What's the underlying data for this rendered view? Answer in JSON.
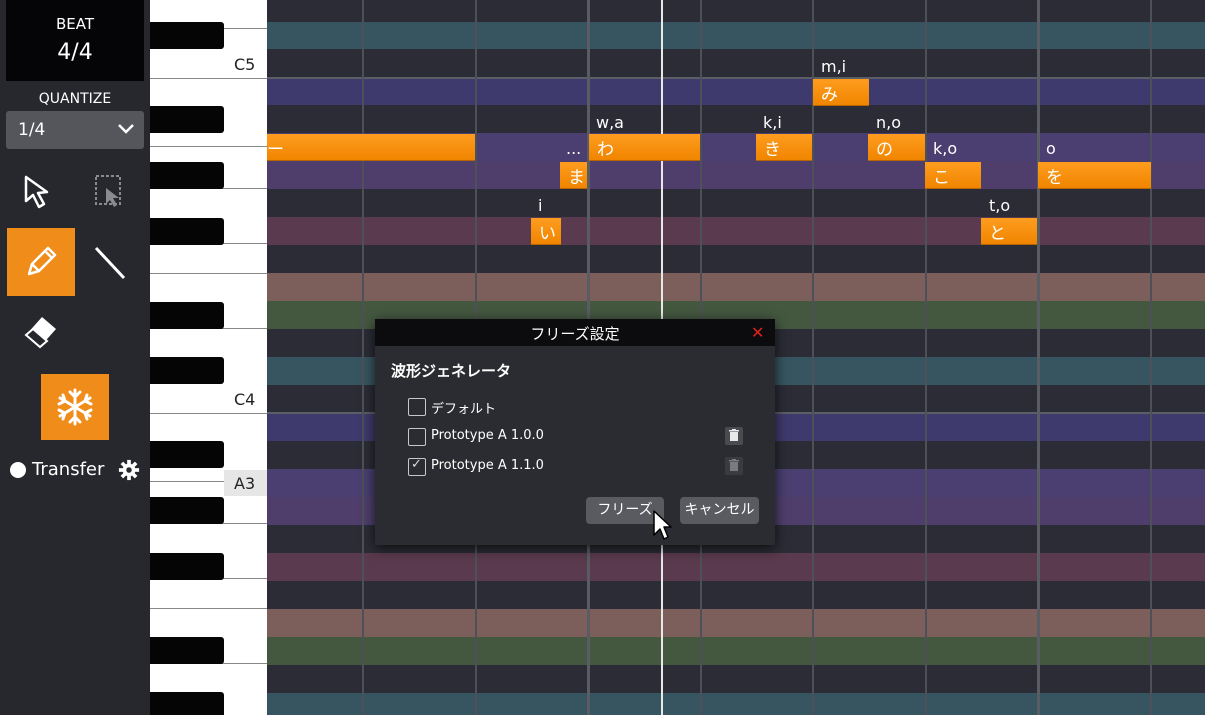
{
  "sidebar": {
    "beat_label": "BEAT",
    "beat_value": "4/4",
    "quantize_label": "QUANTIZE",
    "quantize_value": "1/4",
    "transfer_label": "Transfer"
  },
  "piano": {
    "labels": [
      "C5",
      "C4",
      "A3"
    ]
  },
  "notes": [
    {
      "lyric": "ー"
    },
    {
      "lyric": "ま"
    },
    {
      "lyric": "わ"
    },
    {
      "lyric": "き"
    },
    {
      "lyric": "の"
    },
    {
      "lyric": "み"
    },
    {
      "lyric": "こ"
    },
    {
      "lyric": "を"
    },
    {
      "lyric": "い"
    },
    {
      "lyric": "と"
    }
  ],
  "phonemes": [
    "m,i",
    "w,a",
    "k,i",
    "n,o",
    "k,o",
    "o",
    "...",
    "i",
    "t,o"
  ],
  "dialog": {
    "title": "フリーズ設定",
    "close": "✕",
    "heading": "波形ジェネレータ",
    "options": [
      {
        "label": "デフォルト",
        "checked": false
      },
      {
        "label": "Prototype A 1.0.0",
        "checked": false
      },
      {
        "label": "Prototype A 1.1.0",
        "checked": true
      }
    ],
    "freeze_button": "フリーズ",
    "cancel_button": "キャンセル"
  },
  "colors": {
    "accent": "#f08c1a",
    "sidebar_bg": "#27282d",
    "grid_bg": "#2b2c35"
  },
  "icons": [
    "select-arrow-icon",
    "rect-select-icon",
    "pencil-icon",
    "line-icon",
    "eraser-icon",
    "snowflake-icon",
    "gear-icon",
    "chevron-down-icon",
    "trash-icon"
  ]
}
